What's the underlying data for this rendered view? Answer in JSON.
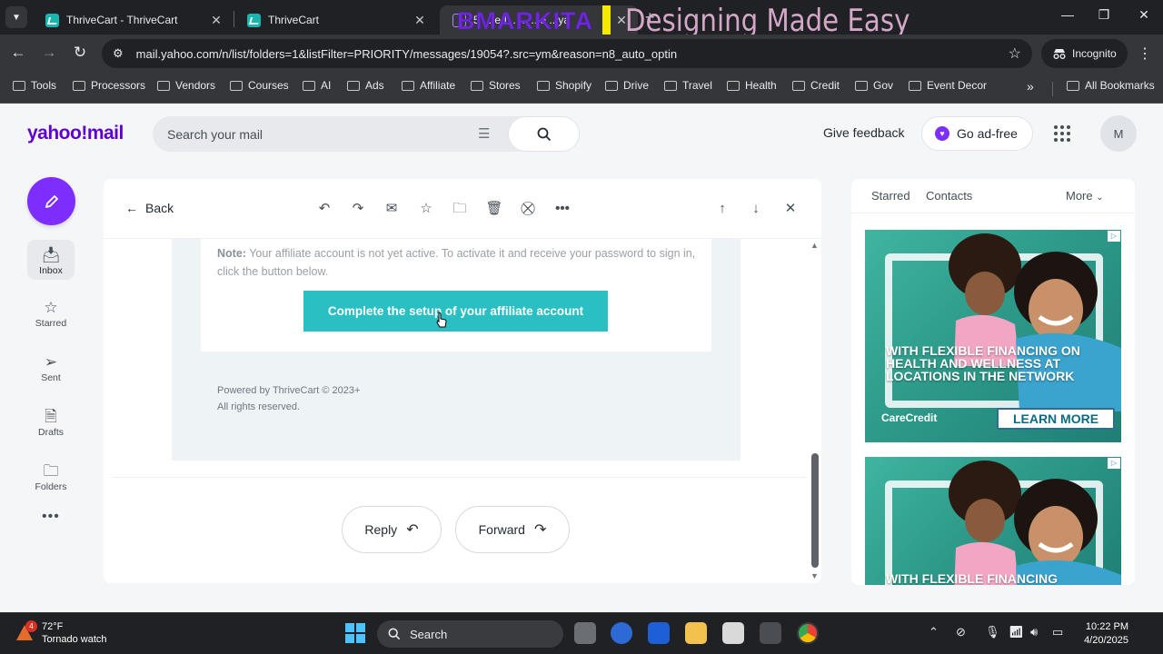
{
  "browser": {
    "tabs": [
      {
        "title": "ThriveCart - ThriveCart",
        "close": "✕"
      },
      {
        "title": "ThriveCart",
        "close": "✕"
      },
      {
        "title": "5 ... ed... ... ...e ...ya",
        "close": "✕"
      }
    ],
    "new_tab": "+",
    "window_controls": {
      "minimize": "—",
      "maximize": "❐",
      "close": "✕"
    },
    "url": "mail.yahoo.com/n/list/folders=1&listFilter=PRIORITY/messages/19054?.src=ym&reason=n8_auto_optin",
    "incognito_label": "Incognito",
    "bookmarks": [
      "Tools",
      "Processors",
      "Vendors",
      "Courses",
      "AI",
      "Ads",
      "Affiliate",
      "Stores",
      "Shopify",
      "Drive",
      "Travel",
      "Health",
      "Credit",
      "Gov",
      "Event Decor"
    ],
    "all_bookmarks": "All Bookmarks",
    "overflow": "»"
  },
  "overlay": {
    "name": "BMARKITA",
    "tagline": "Designing Made Easy"
  },
  "yahoo": {
    "logo": "yahoo!mail",
    "search_placeholder": "Search your mail",
    "feedback": "Give feedback",
    "adfree": "Go ad-free",
    "avatar_initial": "M"
  },
  "rail": {
    "inbox": "Inbox",
    "starred": "Starred",
    "sent": "Sent",
    "drafts": "Drafts",
    "folders": "Folders",
    "more": "•••"
  },
  "message": {
    "back": "Back",
    "note_label": "Note:",
    "note_text": " Your affiliate account is not yet active. To activate it and receive your password to sign in, click the button below.",
    "cta": "Complete the setup of your affiliate account",
    "footer_line1": "Powered by ThriveCart © 2023+",
    "footer_line2": "All rights reserved.",
    "reply": "Reply",
    "forward": "Forward"
  },
  "right_column": {
    "tabs": [
      "Starred",
      "Contacts"
    ],
    "more": "More",
    "ad": {
      "headline": "WITH FLEXIBLE FINANCING ON HEALTH AND WELLNESS AT LOCATIONS IN THE NETWORK",
      "headline_short": "WITH FLEXIBLE FINANCING",
      "brand": "CareCredit",
      "button": "LEARN MORE",
      "badge": "▷"
    }
  },
  "taskbar": {
    "temp": "72°F",
    "weather_alert": "Tornado watch",
    "badge": "4",
    "search_placeholder": "Search",
    "time": "10:22 PM",
    "date": "4/20/2025"
  }
}
